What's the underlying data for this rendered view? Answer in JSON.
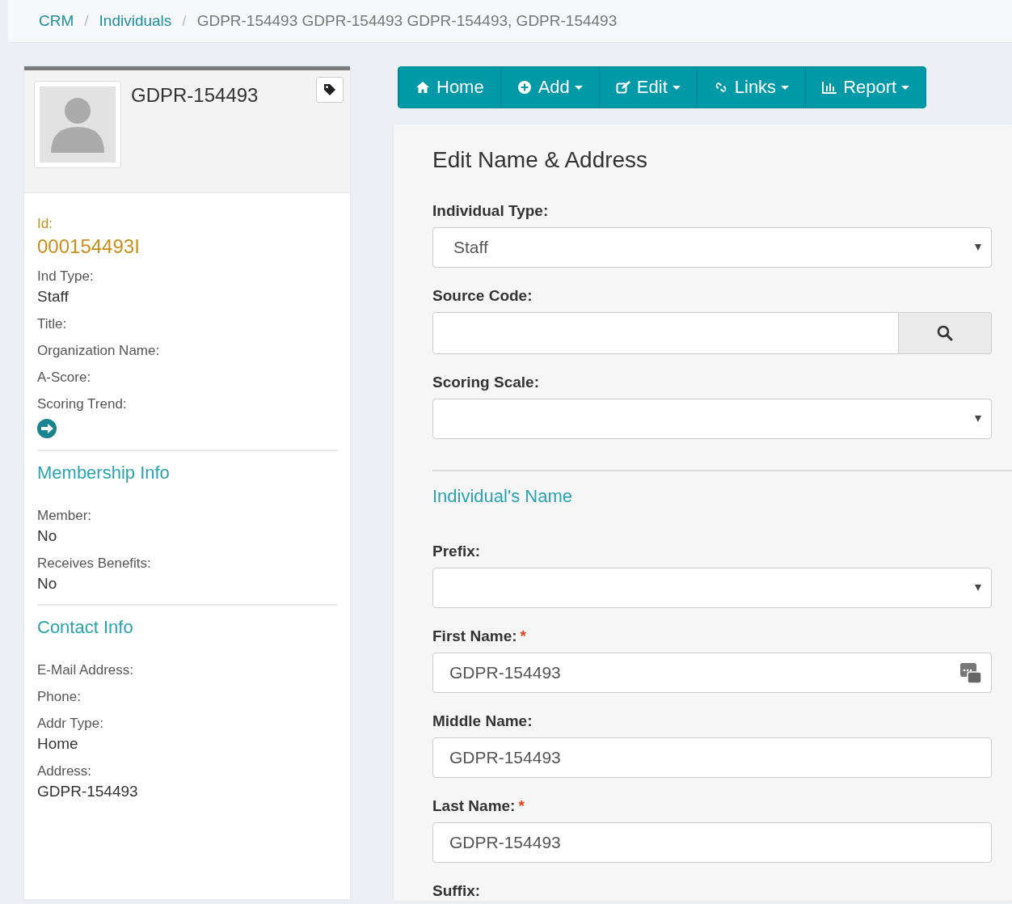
{
  "breadcrumb": [
    {
      "kind": "link",
      "label": "CRM"
    },
    {
      "kind": "separator",
      "label": "/"
    },
    {
      "kind": "link",
      "label": "Individuals"
    },
    {
      "kind": "separator",
      "label": "/"
    },
    {
      "kind": "current",
      "label": "GDPR-154493 GDPR-154493 GDPR-154493, GDPR-154493"
    }
  ],
  "profile": {
    "name": "GDPR-154493",
    "sections": [
      {
        "fields": [
          {
            "label": "Id:",
            "value": "000154493I",
            "kind": "id"
          },
          {
            "label": "Ind Type:",
            "value": "Staff",
            "kind": "text"
          },
          {
            "label": "Title:",
            "kind": "text"
          },
          {
            "label": "Organization Name:",
            "kind": "text"
          },
          {
            "label": "A-Score:",
            "kind": "text"
          },
          {
            "label": "Scoring Trend:",
            "kind": "trend"
          }
        ]
      },
      {
        "heading": "Membership Info",
        "fields": [
          {
            "label": "Member:",
            "value": "No",
            "kind": "text"
          },
          {
            "label": "Receives Benefits:",
            "value": "No",
            "kind": "text"
          }
        ]
      },
      {
        "heading": "Contact Info",
        "fields": [
          {
            "label": "E-Mail Address:",
            "kind": "text"
          },
          {
            "label": "Phone:",
            "kind": "text"
          },
          {
            "label": "Addr Type:",
            "value": "Home",
            "kind": "text"
          },
          {
            "label": "Address:",
            "value": "GDPR-154493",
            "kind": "text"
          }
        ]
      }
    ]
  },
  "toolbar": [
    {
      "label": "Home",
      "dropdown": false
    },
    {
      "label": "Add",
      "dropdown": true
    },
    {
      "label": "Edit",
      "dropdown": true
    },
    {
      "label": "Links",
      "dropdown": true
    },
    {
      "label": "Report",
      "dropdown": true
    }
  ],
  "form": {
    "title": "Edit Name & Address",
    "items": [
      {
        "kind": "select",
        "label": "Individual Type:",
        "value": "Staff"
      },
      {
        "kind": "lookup",
        "label": "Source Code:"
      },
      {
        "kind": "select",
        "label": "Scoring Scale:"
      },
      {
        "kind": "heading",
        "label": "Individual's Name"
      },
      {
        "kind": "select",
        "label": "Prefix:"
      },
      {
        "kind": "text",
        "label": "First Name:",
        "required_mark": "*",
        "value": "GDPR-154493",
        "badge": true
      },
      {
        "kind": "text",
        "label": "Middle Name:",
        "value": "GDPR-154493"
      },
      {
        "kind": "text",
        "label": "Last Name:",
        "required_mark": "*",
        "value": "GDPR-154493"
      },
      {
        "kind": "label",
        "label": "Suffix:"
      }
    ]
  }
}
